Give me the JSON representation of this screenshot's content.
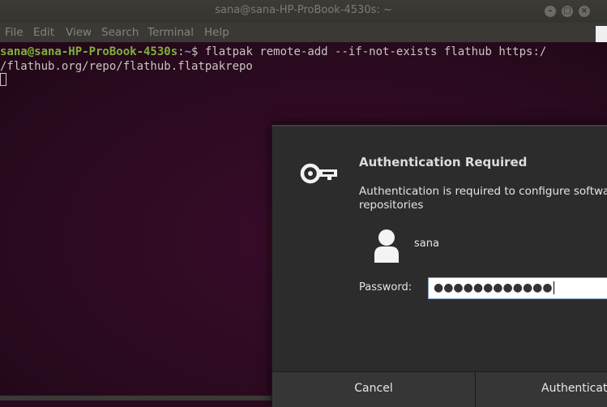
{
  "window": {
    "title": "sana@sana-HP-ProBook-4530s: ~",
    "controls": {
      "minimize": "–",
      "maximize": "□",
      "close": "×"
    }
  },
  "menu": [
    "File",
    "Edit",
    "View",
    "Search",
    "Terminal",
    "Help"
  ],
  "terminal": {
    "prompt_user": "sana@sana-HP-ProBook-4530s",
    "prompt_sep": ":",
    "prompt_path": "~",
    "prompt_symbol": "$ ",
    "command_line1": "flatpak remote-add --if-not-exists flathub https:/",
    "command_line2": "/flathub.org/repo/flathub.flatpakrepo"
  },
  "dialog": {
    "title": "Authentication Required",
    "message_line1": "Authentication is required to configure software",
    "message_line2": "repositories",
    "username": "sana",
    "password_label": "Password:",
    "password_value": "●●●●●●●●●●●●",
    "cancel_label": "Cancel",
    "authenticate_label": "Authenticate"
  }
}
